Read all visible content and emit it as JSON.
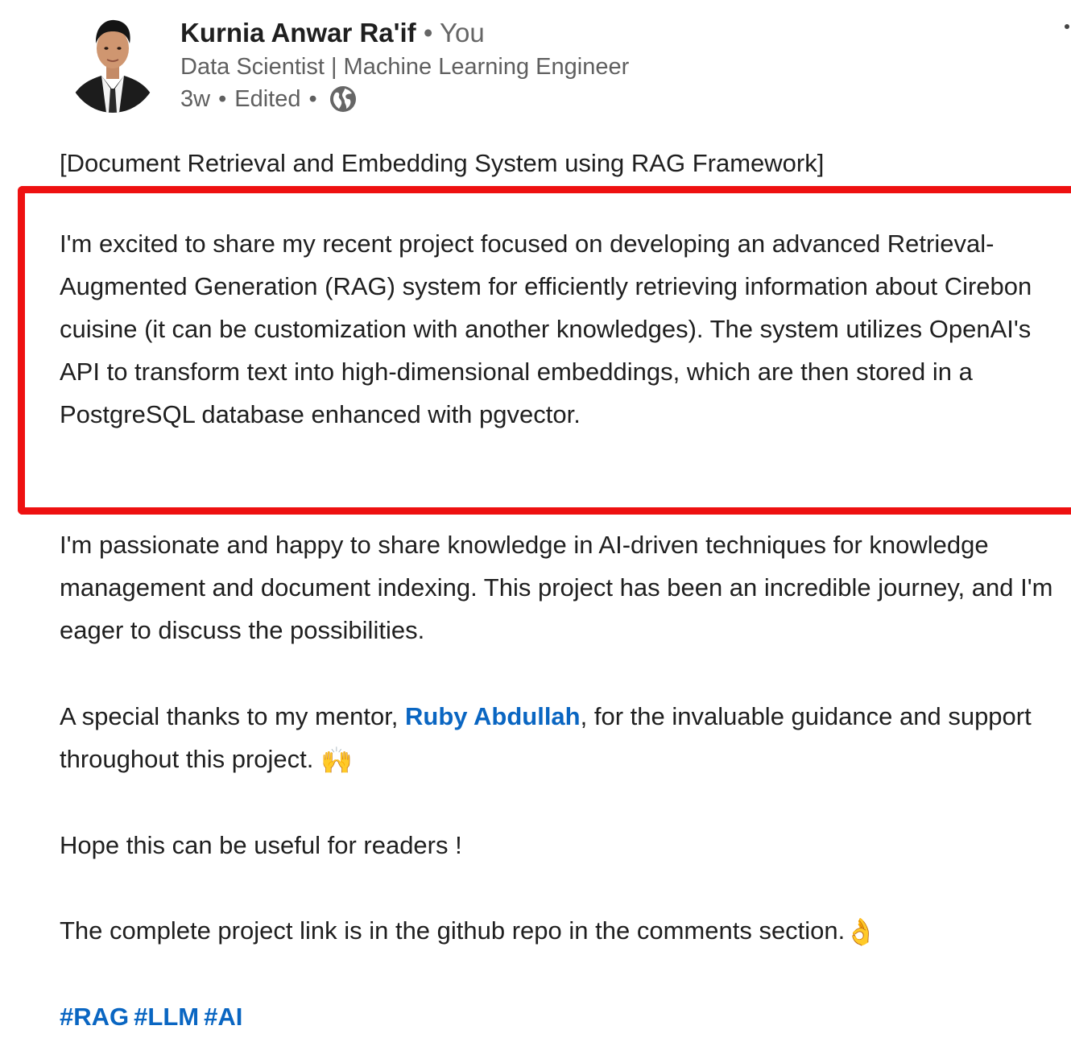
{
  "author": {
    "name": "Kurnia Anwar Ra'if",
    "separator": "•",
    "degree": "You",
    "headline": "Data Scientist | Machine Learning Engineer",
    "time": "3w",
    "edited": "Edited",
    "visibility_icon": "globe-icon"
  },
  "post": {
    "title": "[Document Retrieval and Embedding System using RAG Framework]",
    "intro": "I'm excited to share my recent project focused on developing an advanced Retrieval-Augmented Generation (RAG) system for efficiently retrieving information about Cirebon cuisine (it can be customization with another knowledges). The system utilizes OpenAI's API to transform text into high-dimensional embeddings, which are then stored in a PostgreSQL database enhanced with pgvector.",
    "passion": "I'm passionate and happy to share knowledge in AI-driven techniques for knowledge management and document indexing. This project has been an incredible journey, and I'm eager to discuss the possibilities.",
    "thanks_before": "A special thanks to my mentor, ",
    "mention": "Ruby Abdullah",
    "thanks_after": ", for the invaluable guidance and support throughout this project. ",
    "thanks_emoji": "🙌",
    "hope": "Hope this can be useful for readers !",
    "link_note": "The complete project link is in the github repo in the comments section.",
    "link_emoji": "👌",
    "hashtags": [
      "#RAG",
      "#LLM",
      "#AI"
    ]
  },
  "colors": {
    "highlight_border": "#ee1111",
    "link": "#0a66c2",
    "text": "#1f1f1f",
    "muted": "#5f5f5f"
  }
}
